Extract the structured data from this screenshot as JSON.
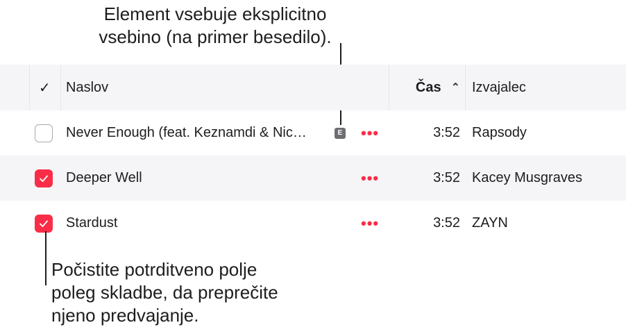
{
  "annotations": {
    "top_line1": "Element vsebuje eksplicitno",
    "top_line2": "vsebino (na primer besedilo).",
    "bottom_line1": "Počistite potrditveno polje",
    "bottom_line2": "poleg skladbe, da preprečite",
    "bottom_line3": "njeno predvajanje."
  },
  "header": {
    "check_glyph": "✓",
    "title": "Naslov",
    "time": "Čas",
    "sort_glyph": "⌃",
    "artist": "Izvajalec"
  },
  "rows": [
    {
      "checked": false,
      "title": "Never Enough (feat. Keznamdi & Nic…",
      "explicit": "E",
      "more": "•••",
      "time": "3:52",
      "artist": "Rapsody"
    },
    {
      "checked": true,
      "title": "Deeper Well",
      "more": "•••",
      "time": "3:52",
      "artist": "Kacey Musgraves"
    },
    {
      "checked": true,
      "title": "Stardust",
      "more": "•••",
      "time": "3:52",
      "artist": "ZAYN"
    }
  ],
  "colors": {
    "accent": "#fa2d48",
    "header_bg": "#f5f5f7"
  }
}
